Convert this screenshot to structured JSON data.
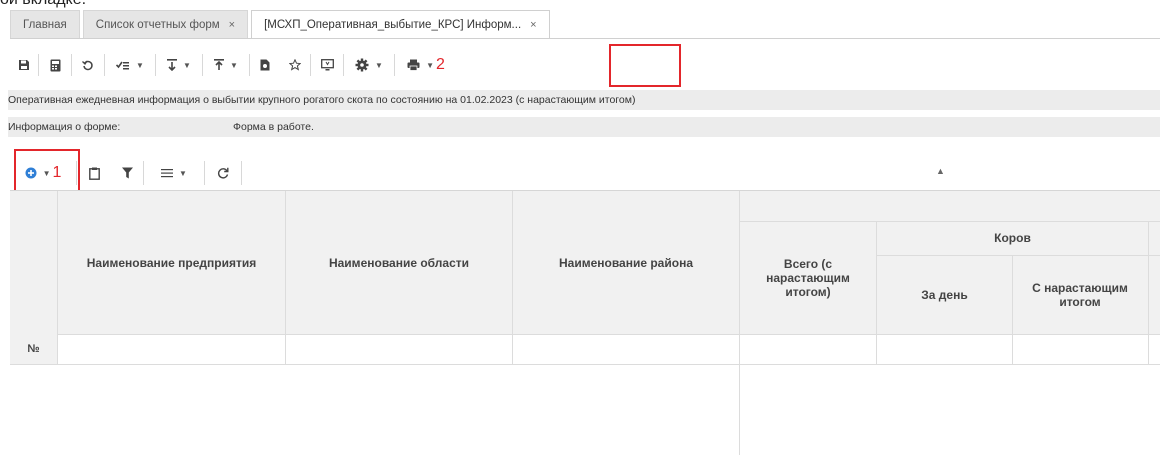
{
  "caption_fragment": "ой вкладке.",
  "tabs": [
    {
      "label": "Главная",
      "closable": false,
      "active": false
    },
    {
      "label": "Список отчетных форм",
      "closable": true,
      "active": false
    },
    {
      "label": "[МСХП_Оперативная_выбытие_КРС] Информ...",
      "closable": true,
      "active": true
    }
  ],
  "tab_close_glyph": "×",
  "toolbar": {
    "icons": [
      "save-icon",
      "calculator-icon",
      "undo-icon",
      "checklist-icon",
      "import-icon",
      "export-icon",
      "document-icon",
      "star-icon",
      "monitor-icon",
      "gear-icon",
      "print-icon"
    ],
    "print_marker": "2"
  },
  "form_title": "Оперативная ежедневная информация о выбытии крупного рогатого скота по состоянию на 01.02.2023 (с нарастающим итогом)",
  "form_info": {
    "label": "Информация о форме:",
    "value": "Форма в работе."
  },
  "grid_toolbar": {
    "icons": [
      "add-circle-icon",
      "clipboard-icon",
      "filter-icon",
      "list-icon",
      "refresh-icon"
    ],
    "add_marker": "1"
  },
  "table": {
    "columns": {
      "enterprise": "Наименование предприятия",
      "region": "Наименование области",
      "district": "Наименование района",
      "total": "Всего (с нарастающим итогом)",
      "cows_group": "Коров",
      "cows_day": "За день",
      "cows_cumulative": "С нарастающим итогом"
    },
    "row_number_label": "№"
  },
  "colors": {
    "highlight": "#e3262b",
    "header_bg": "#f1f1f1",
    "info_bg": "#ececec"
  }
}
